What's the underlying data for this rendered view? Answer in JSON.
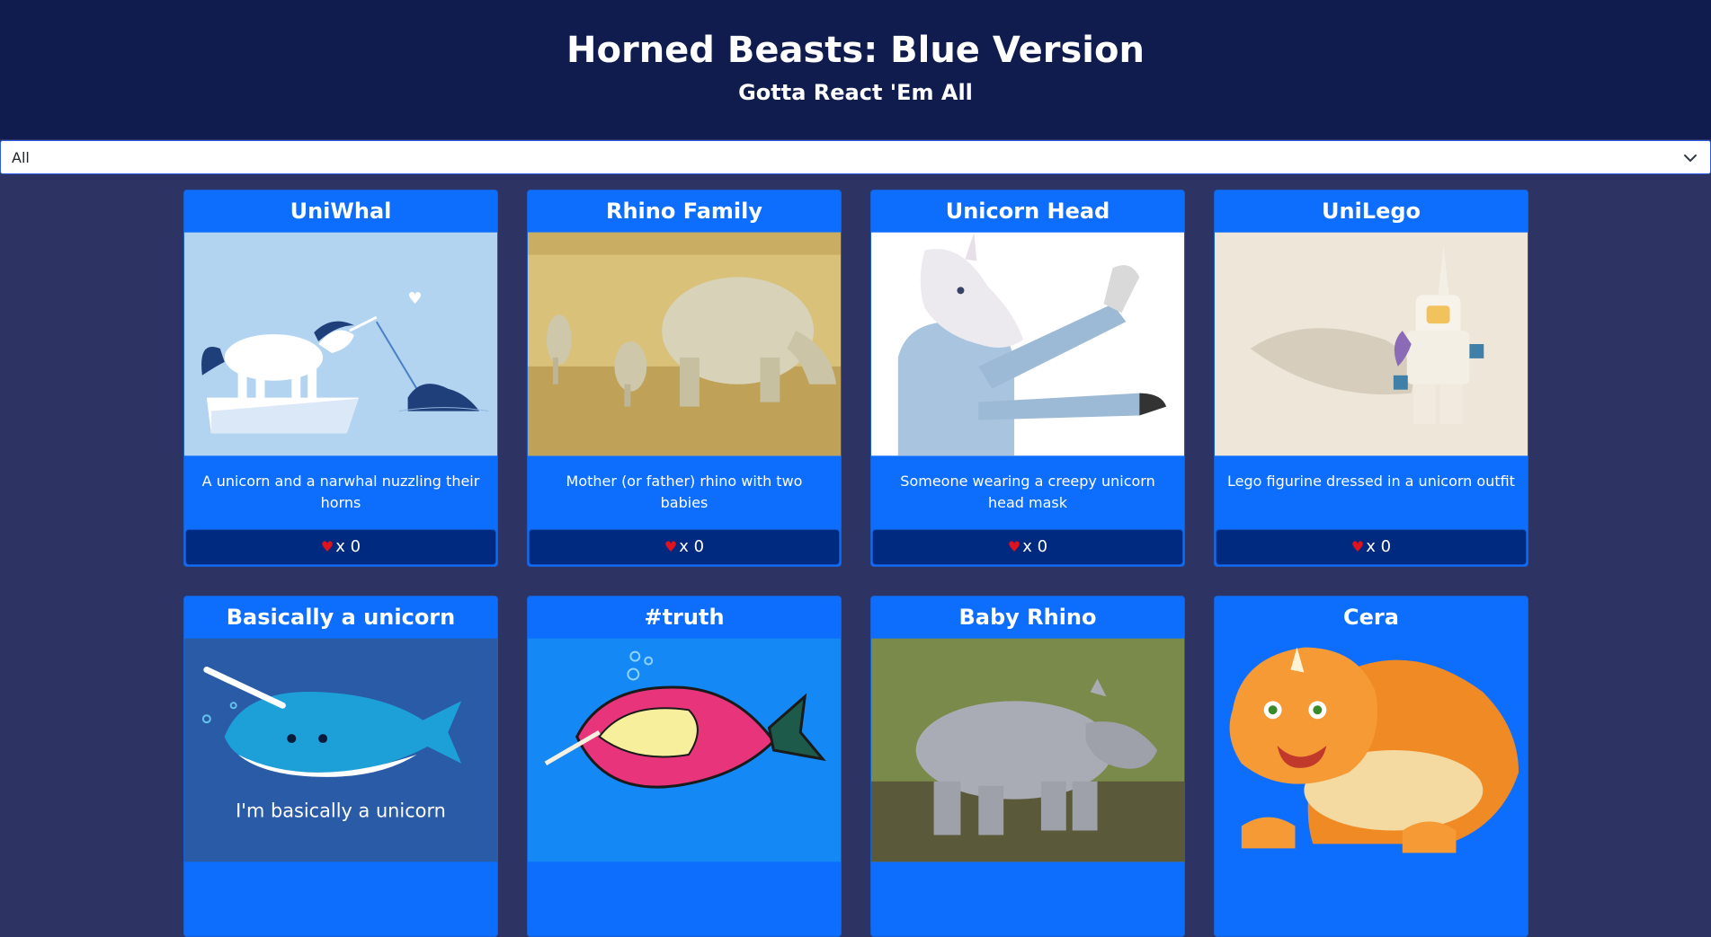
{
  "header": {
    "title": "Horned Beasts: Blue Version",
    "subtitle": "Gotta React 'Em All"
  },
  "filter": {
    "selected": "All"
  },
  "cards": [
    {
      "title": "UniWhal",
      "description": "A unicorn and a narwhal nuzzling their horns",
      "favorites": "x 0"
    },
    {
      "title": "Rhino Family",
      "description": "Mother (or father) rhino with two babies",
      "favorites": "x 0"
    },
    {
      "title": "Unicorn Head",
      "description": "Someone wearing a creepy unicorn head mask",
      "favorites": "x 0"
    },
    {
      "title": "UniLego",
      "description": "Lego figurine dressed in a unicorn outfit",
      "favorites": "x 0"
    },
    {
      "title": "Basically a unicorn",
      "image_caption": "I'm basically a unicorn"
    },
    {
      "title": "#truth"
    },
    {
      "title": "Baby Rhino"
    },
    {
      "title": "Cera"
    }
  ],
  "colors": {
    "header_bg": "#101b4e",
    "page_bg": "#2d3362",
    "card_bg": "#0d6efd",
    "fav_bar_bg": "#002a80",
    "heart": "#e2121c"
  },
  "icons": {
    "favorite": "heart-icon",
    "dropdown": "chevron-down-icon"
  }
}
